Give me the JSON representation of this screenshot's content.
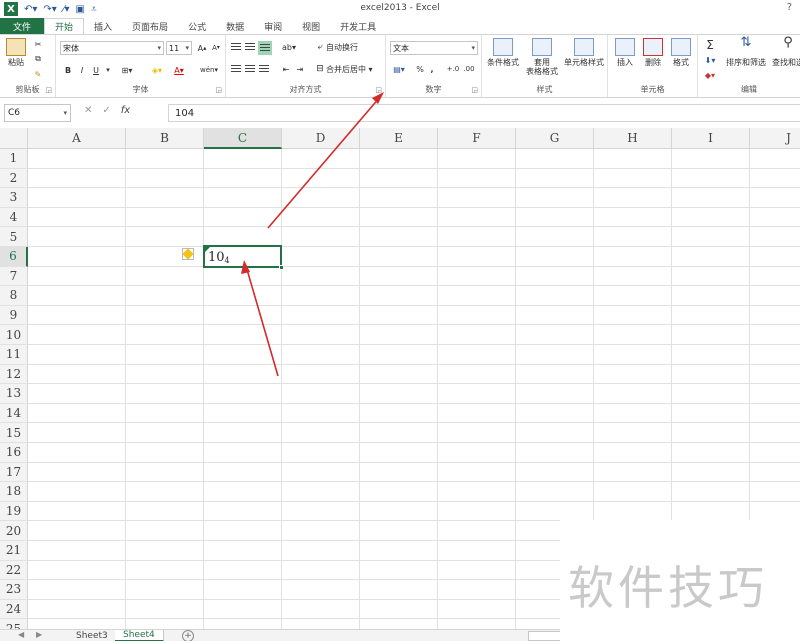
{
  "window": {
    "title": "excel2013 - Excel",
    "help": "?",
    "app_icon_label": "X"
  },
  "tabs": [
    {
      "label": "文件"
    },
    {
      "label": "开始"
    },
    {
      "label": "插入"
    },
    {
      "label": "页面布局"
    },
    {
      "label": "公式"
    },
    {
      "label": "数据"
    },
    {
      "label": "审阅"
    },
    {
      "label": "视图"
    },
    {
      "label": "开发工具"
    }
  ],
  "ribbon": {
    "clipboard": {
      "label": "剪贴板",
      "paste": "粘贴"
    },
    "font": {
      "label": "字体",
      "name": "宋体",
      "size": "11",
      "bold": "B",
      "italic": "I",
      "underline": "U",
      "grow": "A",
      "shrink": "A",
      "font_color_glyph": "A",
      "wen": "wén"
    },
    "alignment": {
      "label": "对齐方式",
      "wrap": "自动换行",
      "merge": "合并后居中"
    },
    "number": {
      "label": "数字",
      "format": "文本",
      "percent": "%",
      "comma": ",",
      "inc_dec": "+.0",
      "dec_dec": ".00"
    },
    "styles": {
      "label": "样式",
      "conditional": "条件格式",
      "table": "套用\n表格格式",
      "cell": "单元格样式"
    },
    "cells": {
      "label": "单元格",
      "insert": "插入",
      "delete": "删除",
      "format": "格式"
    },
    "editing": {
      "label": "编辑",
      "sum": "Σ",
      "sort": "排序和筛选",
      "find": "查找和选"
    }
  },
  "formula_bar": {
    "name_box": "C6",
    "cancel": "✕",
    "enter": "✓",
    "fx": "fx",
    "value": "104"
  },
  "grid": {
    "columns": [
      "A",
      "B",
      "C",
      "D",
      "E",
      "F",
      "G",
      "H",
      "I",
      "J"
    ],
    "rows": [
      "1",
      "2",
      "3",
      "4",
      "5",
      "6",
      "7",
      "8",
      "9",
      "10",
      "11",
      "12",
      "13",
      "14",
      "15",
      "16",
      "17",
      "18",
      "19",
      "20",
      "21",
      "22",
      "23",
      "24",
      "25"
    ],
    "selected_column": "C",
    "selected_row": "6",
    "active_cell_base": "10",
    "active_cell_exp": "4"
  },
  "sheets": {
    "nav_prev": "◀",
    "nav_next": "▶",
    "tabs": [
      "Sheet3",
      "Sheet4"
    ],
    "active": "Sheet4",
    "add": "+"
  },
  "watermark": "软件技巧",
  "colors": {
    "accent": "#217346",
    "arrow": "#d42a2a"
  }
}
